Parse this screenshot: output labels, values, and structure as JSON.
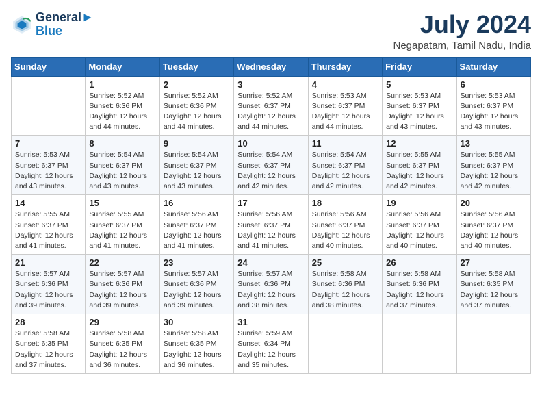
{
  "header": {
    "logo_line1": "General",
    "logo_line2": "Blue",
    "month": "July 2024",
    "location": "Negapatam, Tamil Nadu, India"
  },
  "days_of_week": [
    "Sunday",
    "Monday",
    "Tuesday",
    "Wednesday",
    "Thursday",
    "Friday",
    "Saturday"
  ],
  "weeks": [
    [
      {
        "day": "",
        "info": ""
      },
      {
        "day": "1",
        "info": "Sunrise: 5:52 AM\nSunset: 6:36 PM\nDaylight: 12 hours\nand 44 minutes."
      },
      {
        "day": "2",
        "info": "Sunrise: 5:52 AM\nSunset: 6:36 PM\nDaylight: 12 hours\nand 44 minutes."
      },
      {
        "day": "3",
        "info": "Sunrise: 5:52 AM\nSunset: 6:37 PM\nDaylight: 12 hours\nand 44 minutes."
      },
      {
        "day": "4",
        "info": "Sunrise: 5:53 AM\nSunset: 6:37 PM\nDaylight: 12 hours\nand 44 minutes."
      },
      {
        "day": "5",
        "info": "Sunrise: 5:53 AM\nSunset: 6:37 PM\nDaylight: 12 hours\nand 43 minutes."
      },
      {
        "day": "6",
        "info": "Sunrise: 5:53 AM\nSunset: 6:37 PM\nDaylight: 12 hours\nand 43 minutes."
      }
    ],
    [
      {
        "day": "7",
        "info": "Sunrise: 5:53 AM\nSunset: 6:37 PM\nDaylight: 12 hours\nand 43 minutes."
      },
      {
        "day": "8",
        "info": "Sunrise: 5:54 AM\nSunset: 6:37 PM\nDaylight: 12 hours\nand 43 minutes."
      },
      {
        "day": "9",
        "info": "Sunrise: 5:54 AM\nSunset: 6:37 PM\nDaylight: 12 hours\nand 43 minutes."
      },
      {
        "day": "10",
        "info": "Sunrise: 5:54 AM\nSunset: 6:37 PM\nDaylight: 12 hours\nand 42 minutes."
      },
      {
        "day": "11",
        "info": "Sunrise: 5:54 AM\nSunset: 6:37 PM\nDaylight: 12 hours\nand 42 minutes."
      },
      {
        "day": "12",
        "info": "Sunrise: 5:55 AM\nSunset: 6:37 PM\nDaylight: 12 hours\nand 42 minutes."
      },
      {
        "day": "13",
        "info": "Sunrise: 5:55 AM\nSunset: 6:37 PM\nDaylight: 12 hours\nand 42 minutes."
      }
    ],
    [
      {
        "day": "14",
        "info": "Sunrise: 5:55 AM\nSunset: 6:37 PM\nDaylight: 12 hours\nand 41 minutes."
      },
      {
        "day": "15",
        "info": "Sunrise: 5:55 AM\nSunset: 6:37 PM\nDaylight: 12 hours\nand 41 minutes."
      },
      {
        "day": "16",
        "info": "Sunrise: 5:56 AM\nSunset: 6:37 PM\nDaylight: 12 hours\nand 41 minutes."
      },
      {
        "day": "17",
        "info": "Sunrise: 5:56 AM\nSunset: 6:37 PM\nDaylight: 12 hours\nand 41 minutes."
      },
      {
        "day": "18",
        "info": "Sunrise: 5:56 AM\nSunset: 6:37 PM\nDaylight: 12 hours\nand 40 minutes."
      },
      {
        "day": "19",
        "info": "Sunrise: 5:56 AM\nSunset: 6:37 PM\nDaylight: 12 hours\nand 40 minutes."
      },
      {
        "day": "20",
        "info": "Sunrise: 5:56 AM\nSunset: 6:37 PM\nDaylight: 12 hours\nand 40 minutes."
      }
    ],
    [
      {
        "day": "21",
        "info": "Sunrise: 5:57 AM\nSunset: 6:36 PM\nDaylight: 12 hours\nand 39 minutes."
      },
      {
        "day": "22",
        "info": "Sunrise: 5:57 AM\nSunset: 6:36 PM\nDaylight: 12 hours\nand 39 minutes."
      },
      {
        "day": "23",
        "info": "Sunrise: 5:57 AM\nSunset: 6:36 PM\nDaylight: 12 hours\nand 39 minutes."
      },
      {
        "day": "24",
        "info": "Sunrise: 5:57 AM\nSunset: 6:36 PM\nDaylight: 12 hours\nand 38 minutes."
      },
      {
        "day": "25",
        "info": "Sunrise: 5:58 AM\nSunset: 6:36 PM\nDaylight: 12 hours\nand 38 minutes."
      },
      {
        "day": "26",
        "info": "Sunrise: 5:58 AM\nSunset: 6:36 PM\nDaylight: 12 hours\nand 37 minutes."
      },
      {
        "day": "27",
        "info": "Sunrise: 5:58 AM\nSunset: 6:35 PM\nDaylight: 12 hours\nand 37 minutes."
      }
    ],
    [
      {
        "day": "28",
        "info": "Sunrise: 5:58 AM\nSunset: 6:35 PM\nDaylight: 12 hours\nand 37 minutes."
      },
      {
        "day": "29",
        "info": "Sunrise: 5:58 AM\nSunset: 6:35 PM\nDaylight: 12 hours\nand 36 minutes."
      },
      {
        "day": "30",
        "info": "Sunrise: 5:58 AM\nSunset: 6:35 PM\nDaylight: 12 hours\nand 36 minutes."
      },
      {
        "day": "31",
        "info": "Sunrise: 5:59 AM\nSunset: 6:34 PM\nDaylight: 12 hours\nand 35 minutes."
      },
      {
        "day": "",
        "info": ""
      },
      {
        "day": "",
        "info": ""
      },
      {
        "day": "",
        "info": ""
      }
    ]
  ]
}
